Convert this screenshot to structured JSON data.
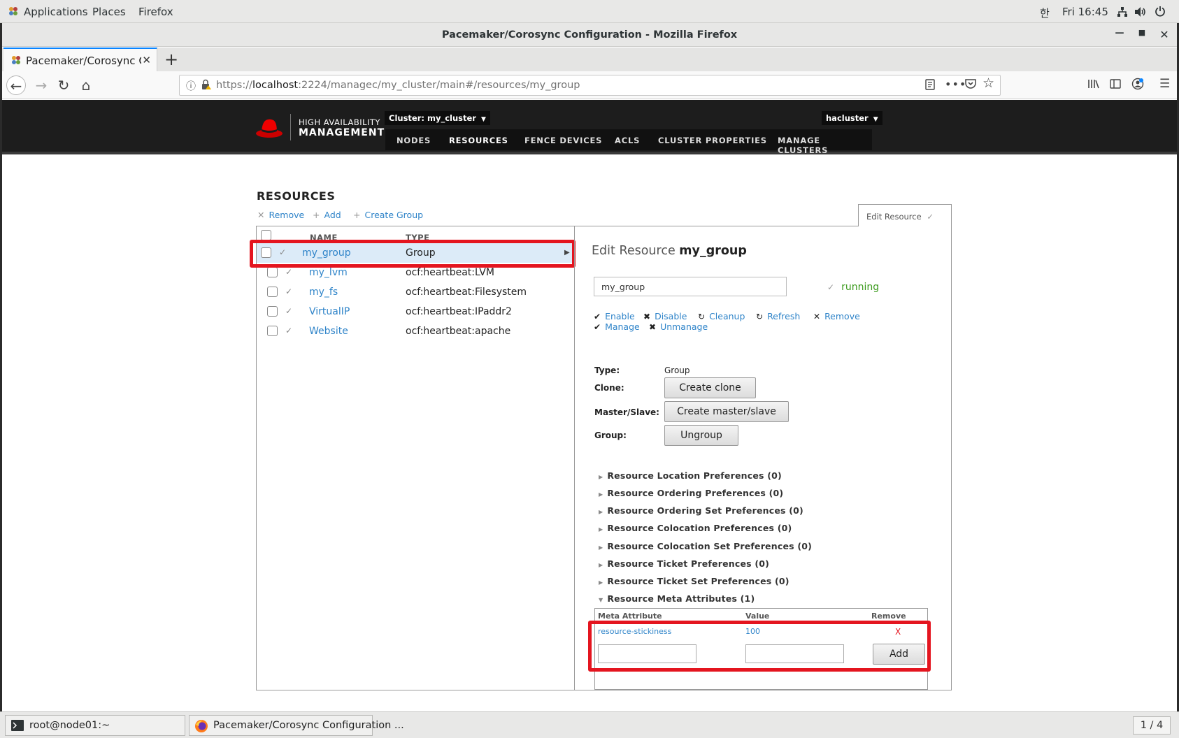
{
  "topbar": {
    "applications": "Applications",
    "places": "Places",
    "firefox": "Firefox",
    "input_method": "한",
    "clock": "Fri 16:45"
  },
  "window": {
    "title": "Pacemaker/Corosync Configuration - Mozilla Firefox"
  },
  "browser": {
    "tab_label": "Pacemaker/Corosync Con",
    "url_prefix": "https://",
    "url_host": "localhost",
    "url_rest": ":2224/managec/my_cluster/main#/resources/my_group"
  },
  "header": {
    "logo_line1": "HIGH AVAILABILITY",
    "logo_line2": "MANAGEMENT",
    "cluster_dropdown": "Cluster: my_cluster",
    "user_dropdown": "hacluster",
    "nav": [
      "NODES",
      "RESOURCES",
      "FENCE DEVICES",
      "ACLS",
      "CLUSTER PROPERTIES",
      "MANAGE CLUSTERS"
    ]
  },
  "resources": {
    "title": "RESOURCES",
    "actions": [
      "Remove",
      "Add",
      "Create Group"
    ],
    "edit_tab": "Edit Resource",
    "col_name": "NAME",
    "col_type": "TYPE",
    "rows": [
      {
        "name": "my_group",
        "type": "Group"
      },
      {
        "name": "my_lvm",
        "type": "ocf:heartbeat:LVM"
      },
      {
        "name": "my_fs",
        "type": "ocf:heartbeat:Filesystem"
      },
      {
        "name": "VirtualIP",
        "type": "ocf:heartbeat:IPaddr2"
      },
      {
        "name": "Website",
        "type": "ocf:heartbeat:apache"
      }
    ]
  },
  "edit": {
    "title_prefix": "Edit Resource",
    "title_name": "my_group",
    "name_value": "my_group",
    "status": "running",
    "actions": [
      "Enable",
      "Disable",
      "Cleanup",
      "Refresh",
      "Remove",
      "Manage",
      "Unmanage"
    ],
    "props": {
      "type_label": "Type:",
      "type_value": "Group",
      "clone_label": "Clone:",
      "clone_btn": "Create clone",
      "ms_label": "Master/Slave:",
      "ms_btn": "Create master/slave",
      "group_label": "Group:",
      "group_btn": "Ungroup"
    },
    "prefs": [
      "Resource Location Preferences (0)",
      "Resource Ordering Preferences (0)",
      "Resource Ordering Set Preferences (0)",
      "Resource Colocation Preferences (0)",
      "Resource Colocation Set Preferences (0)",
      "Resource Ticket Preferences (0)",
      "Resource Ticket Set Preferences (0)",
      "Resource Meta Attributes (1)"
    ],
    "meta": {
      "h_attr": "Meta Attribute",
      "h_value": "Value",
      "h_remove": "Remove",
      "attr": "resource-stickiness",
      "value": "100",
      "remove": "X",
      "add_btn": "Add"
    }
  },
  "taskbar": {
    "terminal": "root@node01:~",
    "firefox": "Pacemaker/Corosync Configuration ...",
    "workspace": "1 / 4"
  },
  "colors": {
    "link": "#2f84c9",
    "highlight_box": "#e4151f",
    "running": "#3c9b1e",
    "header_bg": "#1d1d1d"
  }
}
